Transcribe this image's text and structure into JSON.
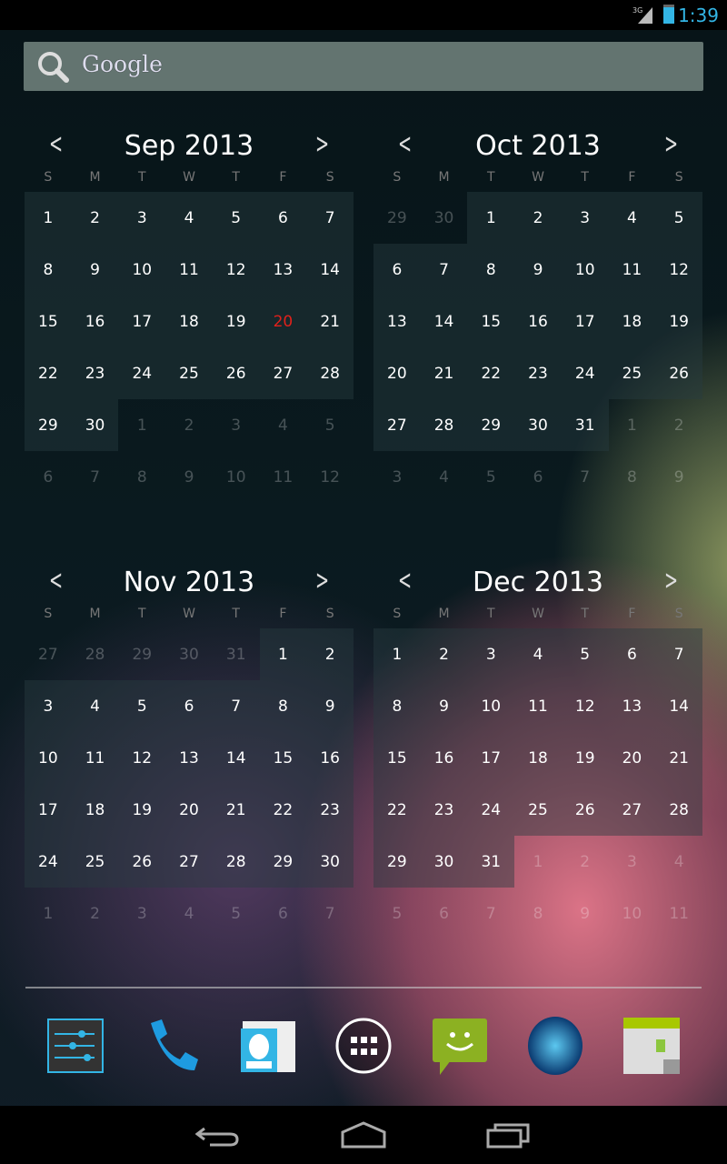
{
  "status": {
    "network": "3G",
    "time": "1:39",
    "accent": "#33b5e5"
  },
  "search": {
    "label": "Google"
  },
  "dow": [
    "S",
    "M",
    "T",
    "W",
    "T",
    "F",
    "S"
  ],
  "calendars": [
    {
      "title": "Sep 2013",
      "days": [
        1,
        2,
        3,
        4,
        5,
        6,
        7,
        8,
        9,
        10,
        11,
        12,
        13,
        14,
        15,
        16,
        17,
        18,
        19,
        20,
        21,
        22,
        23,
        24,
        25,
        26,
        27,
        28,
        29,
        30,
        1,
        2,
        3,
        4,
        5,
        6,
        7,
        8,
        9,
        10,
        11,
        12
      ],
      "in_start": 0,
      "in_end": 29,
      "today_index": 19
    },
    {
      "title": "Oct 2013",
      "days": [
        29,
        30,
        1,
        2,
        3,
        4,
        5,
        6,
        7,
        8,
        9,
        10,
        11,
        12,
        13,
        14,
        15,
        16,
        17,
        18,
        19,
        20,
        21,
        22,
        23,
        24,
        25,
        26,
        27,
        28,
        29,
        30,
        31,
        1,
        2,
        3,
        4,
        5,
        6,
        7,
        8,
        9
      ],
      "in_start": 2,
      "in_end": 32,
      "today_index": -1
    },
    {
      "title": "Nov 2013",
      "days": [
        27,
        28,
        29,
        30,
        31,
        1,
        2,
        3,
        4,
        5,
        6,
        7,
        8,
        9,
        10,
        11,
        12,
        13,
        14,
        15,
        16,
        17,
        18,
        19,
        20,
        21,
        22,
        23,
        24,
        25,
        26,
        27,
        28,
        29,
        30,
        1,
        2,
        3,
        4,
        5,
        6,
        7
      ],
      "in_start": 5,
      "in_end": 34,
      "today_index": -1
    },
    {
      "title": "Dec 2013",
      "days": [
        1,
        2,
        3,
        4,
        5,
        6,
        7,
        8,
        9,
        10,
        11,
        12,
        13,
        14,
        15,
        16,
        17,
        18,
        19,
        20,
        21,
        22,
        23,
        24,
        25,
        26,
        27,
        28,
        29,
        30,
        31,
        1,
        2,
        3,
        4,
        5,
        6,
        7,
        8,
        9,
        10,
        11
      ],
      "in_start": 0,
      "in_end": 30,
      "today_index": -1
    }
  ],
  "today_color": "#e0211b",
  "dock": [
    "settings-icon",
    "phone-icon",
    "contacts-icon",
    "all-apps-icon",
    "messaging-icon",
    "browser-icon",
    "calendar-icon"
  ]
}
